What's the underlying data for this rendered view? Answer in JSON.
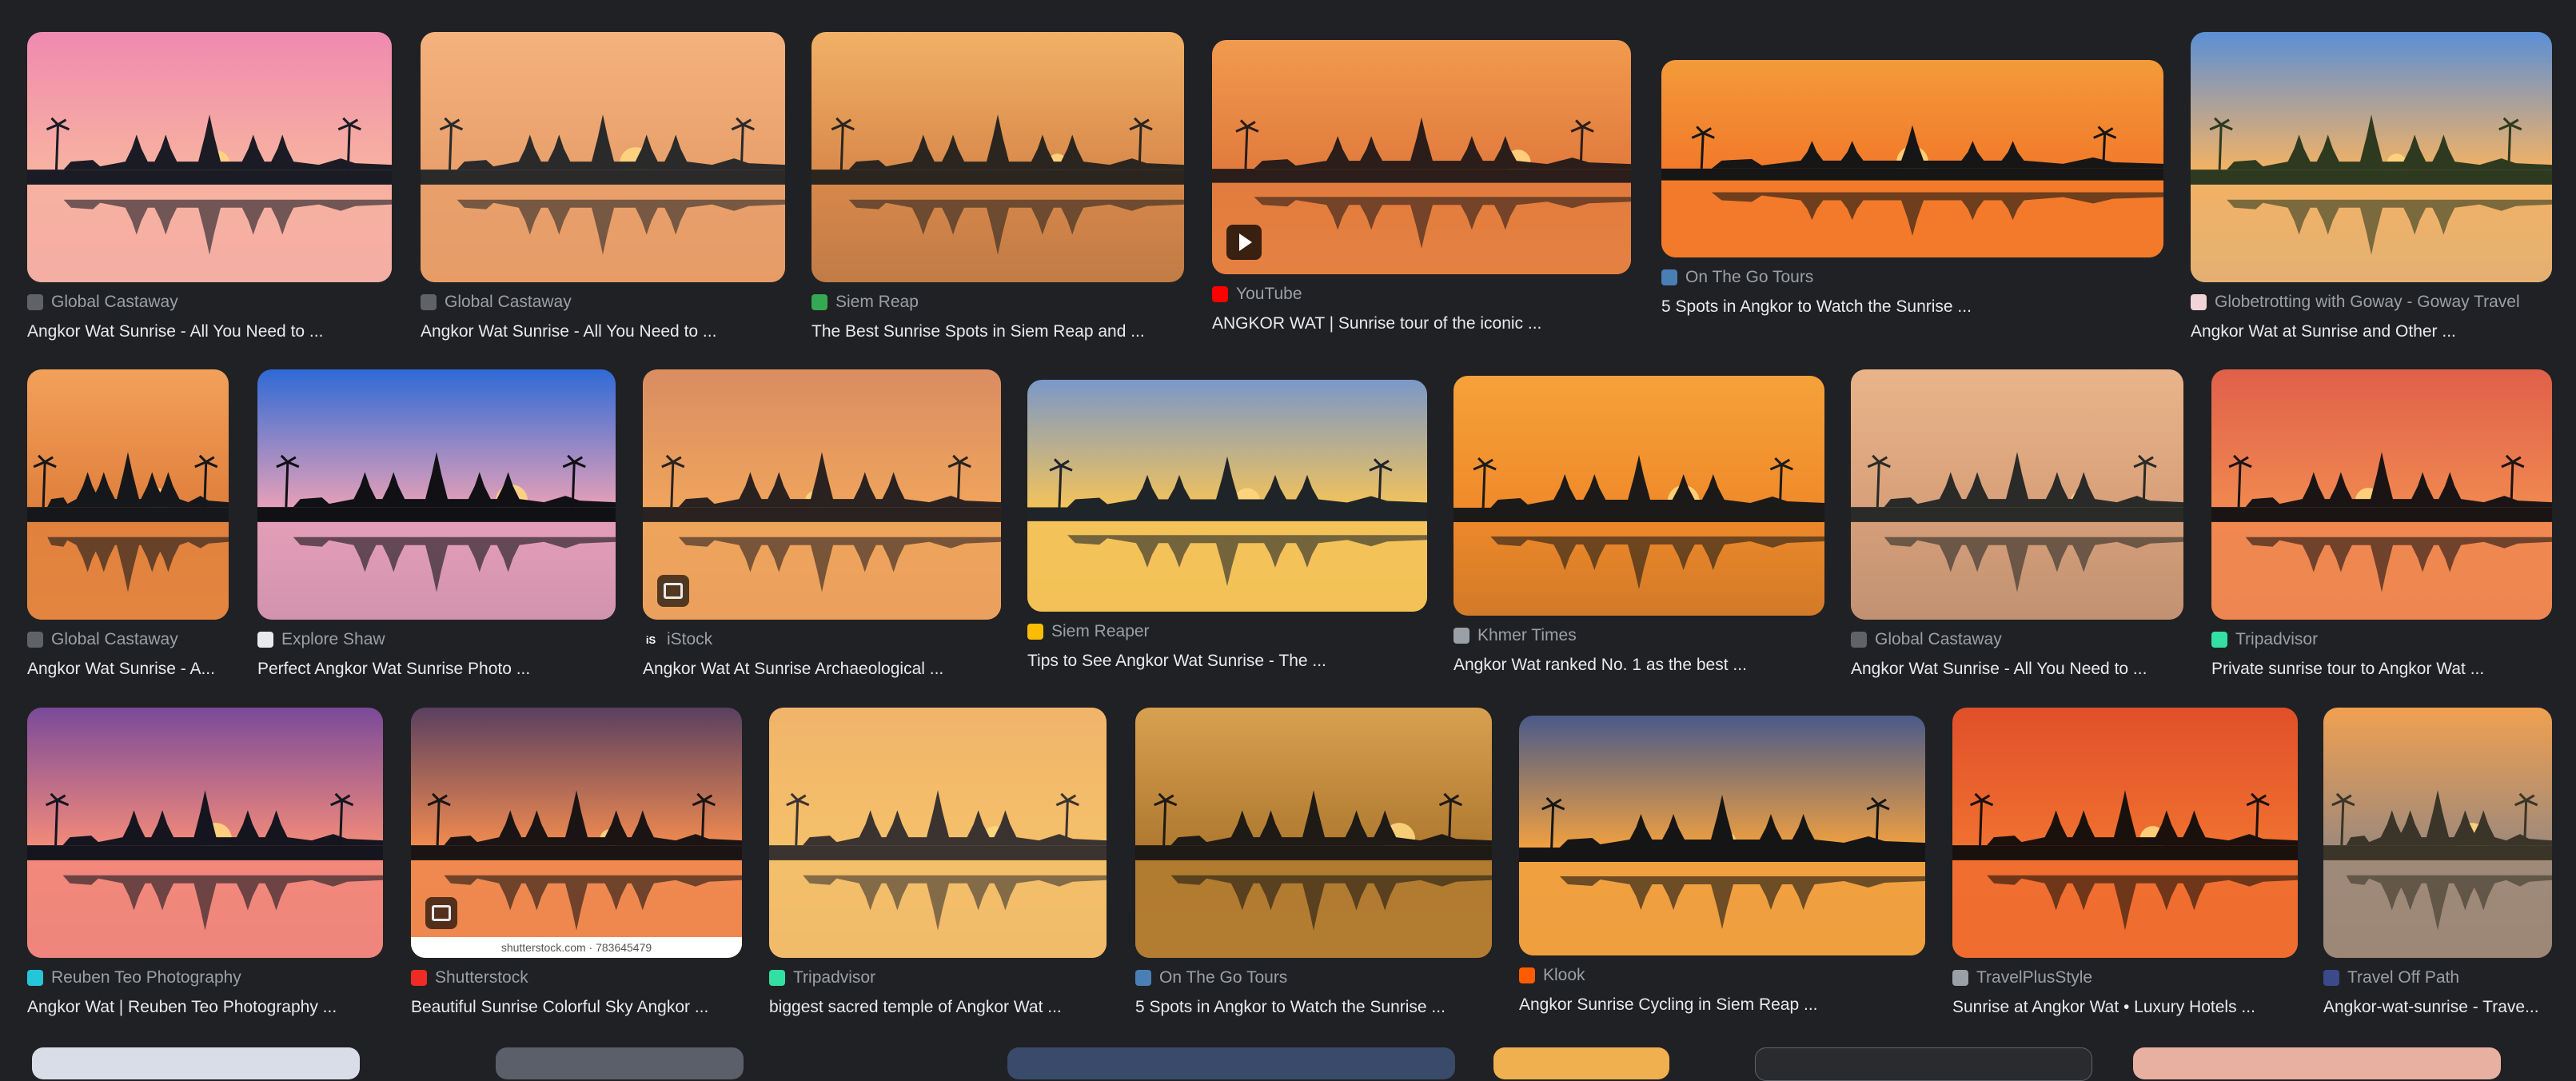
{
  "results": [
    {
      "source": "Global Castaway",
      "title": "Angkor Wat Sunrise - All You Need to ...",
      "fav_color": "#5f6368",
      "fav_glyph": "",
      "palette": [
        "#f08ab0",
        "#f7b2a0",
        "#1b1b25",
        "#e799b6"
      ],
      "video": false
    },
    {
      "source": "Global Castaway",
      "title": "Angkor Wat Sunrise - All You Need to ...",
      "fav_color": "#5f6368",
      "fav_glyph": "",
      "palette": [
        "#f4b27e",
        "#e9a06b",
        "#2a2a2a",
        "#d98857"
      ],
      "video": false
    },
    {
      "source": "Siem Reap",
      "title": "The Best Sunrise Spots in Siem Reap and ...",
      "fav_color": "#34a853",
      "fav_glyph": "",
      "palette": [
        "#f2b066",
        "#d98a4b",
        "#2b2520",
        "#3a2f28"
      ],
      "video": false
    },
    {
      "source": "YouTube",
      "title": "ANGKOR WAT | Sunrise tour of the iconic ...",
      "fav_color": "#ff0000",
      "fav_glyph": "",
      "palette": [
        "#f09a4f",
        "#e27b3d",
        "#2a1d1a",
        "#f0a05a"
      ],
      "video": true
    },
    {
      "source": "On The Go Tours",
      "title": "5 Spots in Angkor to Watch the Sunrise ...",
      "fav_color": "#4a7fb5",
      "fav_glyph": "",
      "palette": [
        "#f39a3a",
        "#f27a2a",
        "#161616",
        "#ef7d2c"
      ],
      "video": false
    },
    {
      "source": "Globetrotting with Goway - Goway Travel",
      "title": "Angkor Wat at Sunrise and Other ...",
      "fav_color": "#f1d4d8",
      "fav_glyph": "",
      "palette": [
        "#5b8fd6",
        "#f3b264",
        "#2e3a20",
        "#8aa9c4"
      ],
      "video": false
    },
    {
      "source": "Global Castaway",
      "title": "Angkor Wat Sunrise - A...",
      "fav_color": "#5f6368",
      "fav_glyph": "",
      "palette": [
        "#f2a05a",
        "#e0803d",
        "#15171a",
        "#f0a552"
      ],
      "video": false
    },
    {
      "source": "Explore Shaw",
      "title": "Perfect Angkor Wat Sunrise Photo ...",
      "fav_color": "#e8eaed",
      "fav_glyph": "",
      "palette": [
        "#2f6ad6",
        "#e6a0b8",
        "#101015",
        "#5a4a70"
      ],
      "video": false
    },
    {
      "source": "iStock",
      "title": "Angkor Wat At Sunrise Archaeological ...",
      "fav_color": "#202124",
      "fav_glyph": "iS",
      "palette": [
        "#d98d62",
        "#f0a45c",
        "#2a2220",
        "#c98a6a"
      ],
      "video": false,
      "badge": true
    },
    {
      "source": "Siem Reaper",
      "title": "Tips to See Angkor Wat Sunrise - The ...",
      "fav_color": "#fbbc04",
      "fav_glyph": "",
      "palette": [
        "#7a98c8",
        "#f3c35a",
        "#1f2429",
        "#f0b540"
      ],
      "video": false
    },
    {
      "source": "Khmer Times",
      "title": "Angkor Wat ranked No. 1 as the best ...",
      "fav_color": "#9aa0a6",
      "fav_glyph": "",
      "palette": [
        "#f5a13a",
        "#f08a2a",
        "#1c1a18",
        "#2b2622"
      ],
      "video": false
    },
    {
      "source": "Global Castaway",
      "title": "Angkor Wat Sunrise - All You Need to ...",
      "fav_color": "#5f6368",
      "fav_glyph": "",
      "palette": [
        "#e9b48a",
        "#d7a07a",
        "#2a2a28",
        "#444"
      ],
      "video": false
    },
    {
      "source": "Tripadvisor",
      "title": "Private sunrise tour to Angkor Wat ...",
      "fav_color": "#34e0a1",
      "fav_glyph": "",
      "palette": [
        "#e0604a",
        "#f08850",
        "#1b1414",
        "#e07a58"
      ],
      "video": false
    },
    {
      "source": "Reuben Teo Photography",
      "title": "Angkor Wat | Reuben Teo Photography ...",
      "fav_color": "#26c6da",
      "fav_glyph": "",
      "palette": [
        "#7a4a9a",
        "#f28a7a",
        "#15151f",
        "#d86a8a"
      ],
      "video": false
    },
    {
      "source": "Shutterstock",
      "title": "Beautiful Sunrise Colorful Sky Angkor ...",
      "fav_color": "#ee2b24",
      "fav_glyph": "",
      "palette": [
        "#5a4060",
        "#f08a50",
        "#1a1414",
        "#e07a48"
      ],
      "video": false,
      "badge": true,
      "watermark": "shutterstock.com · 783645479"
    },
    {
      "source": "Tripadvisor",
      "title": "biggest sacred temple of Angkor Wat ...",
      "fav_color": "#34e0a1",
      "fav_glyph": "",
      "palette": [
        "#f0b46a",
        "#f5c06a",
        "#3a3330",
        "#d9a070"
      ],
      "video": false
    },
    {
      "source": "On The Go Tours",
      "title": "5 Spots in Angkor to Watch the Sunrise ...",
      "fav_color": "#4a7fb5",
      "fav_glyph": "",
      "palette": [
        "#d8a050",
        "#b07a30",
        "#1e1a16",
        "#c08a3a"
      ],
      "video": false
    },
    {
      "source": "Klook",
      "title": "Angkor Sunrise Cycling in Siem Reap ...",
      "fav_color": "#ff5b00",
      "fav_glyph": "",
      "palette": [
        "#4a5a8a",
        "#f0a040",
        "#151515",
        "#e89a3a"
      ],
      "video": false
    },
    {
      "source": "TravelPlusStyle",
      "title": "Sunrise at Angkor Wat • Luxury Hotels ...",
      "fav_color": "#9aa0a6",
      "fav_glyph": "",
      "palette": [
        "#e0502a",
        "#f07030",
        "#1a100c",
        "#e8602a"
      ],
      "video": false
    },
    {
      "source": "Travel Off Path",
      "title": "Angkor-wat-sunrise - Trave...",
      "fav_color": "#3b4a8a",
      "fav_glyph": "",
      "palette": [
        "#f0a050",
        "#a08a7a",
        "#3a3528",
        "#8a7a60"
      ],
      "video": false
    }
  ]
}
